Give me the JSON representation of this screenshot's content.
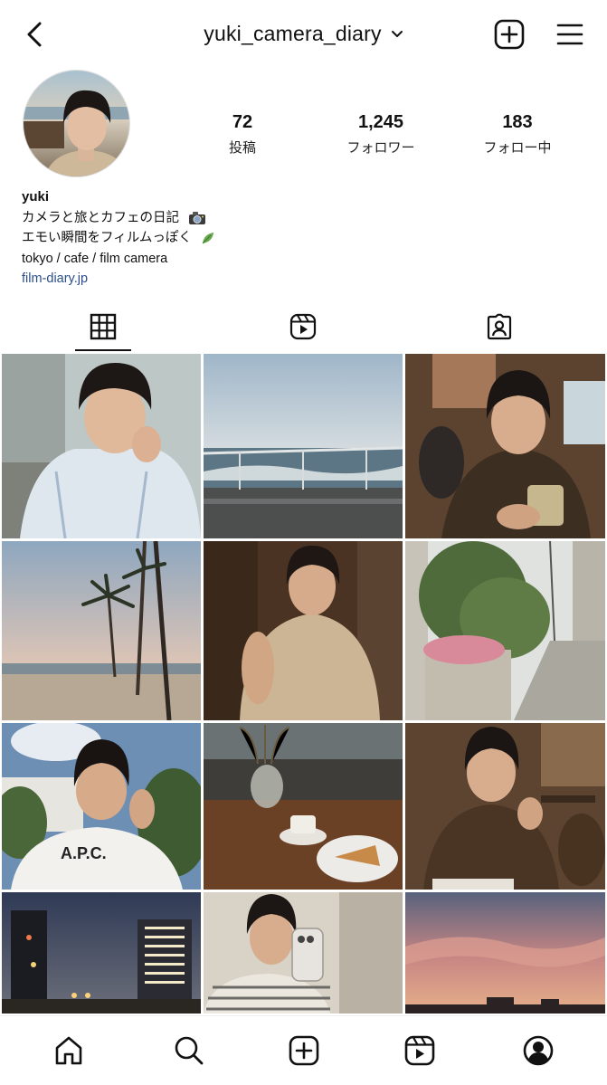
{
  "header": {
    "username": "yuki_camera_diary"
  },
  "stats": {
    "posts": {
      "value": "72",
      "label": "投稿"
    },
    "followers": {
      "value": "1,245",
      "label": "フォロワー"
    },
    "following": {
      "value": "183",
      "label": "フォロー中"
    }
  },
  "bio": {
    "name": "yuki",
    "line1": "カメラと旅とカフェの日記",
    "line2": "エモい瞬間をフィルムっぽく",
    "line3": "tokyo / cafe / film camera",
    "link": "film-diary.jp"
  },
  "tabs": [
    "grid",
    "reels",
    "tagged"
  ],
  "posts": [
    "portrait-striped-shirt",
    "ocean-wave-railing",
    "cafe-drink-portrait",
    "palm-trees-beach",
    "dim-cafe-dress-portrait",
    "street-flowers",
    "apc-tshirt-portrait",
    "coffee-cheesecake-table",
    "cafe-chin-on-hand",
    "city-night-lights",
    "mirror-selfie",
    "sunset-sky"
  ],
  "nav": [
    "home",
    "search",
    "create",
    "reels",
    "profile"
  ],
  "colors": {
    "link": "#2b4f8a",
    "text": "#111111",
    "background": "#ffffff"
  }
}
